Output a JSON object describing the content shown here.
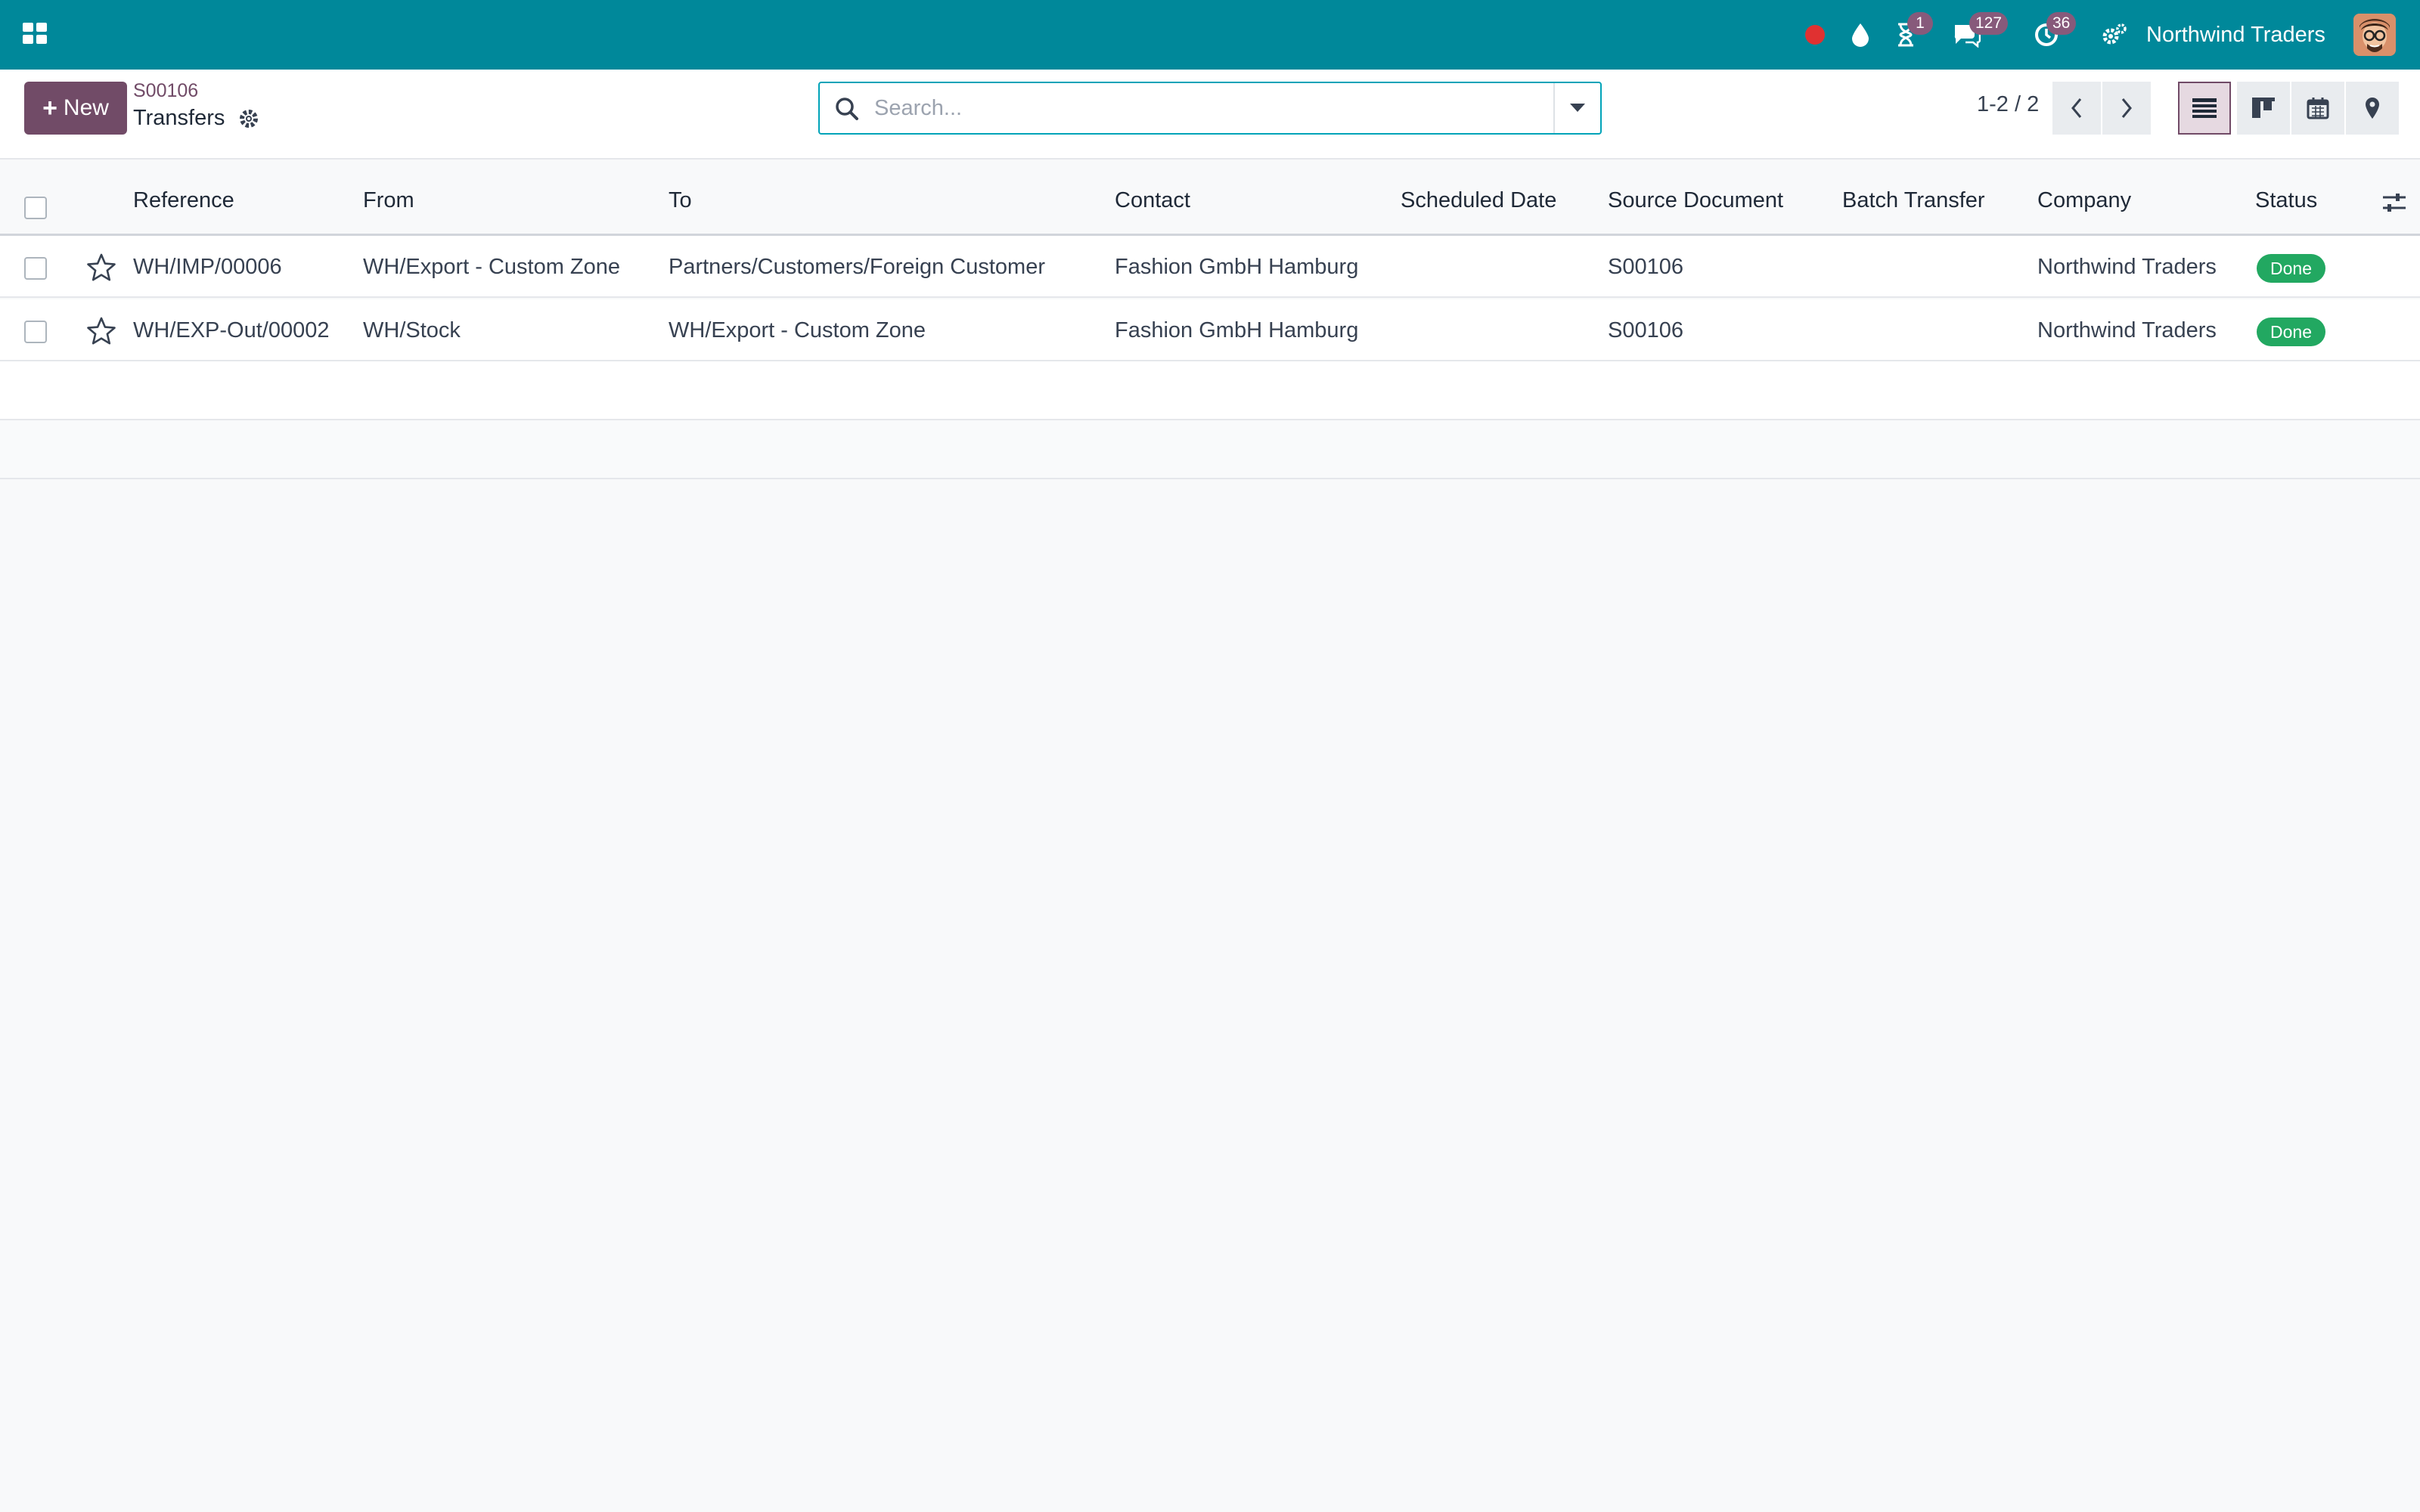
{
  "navbar": {
    "company": "Northwind Traders",
    "badges": {
      "activity": "1",
      "messages": "127",
      "clock": "36"
    },
    "colors": {
      "bar": "#00889a",
      "badge": "#875a7b",
      "recording_dot": "#e03131"
    }
  },
  "control_panel": {
    "new_label": "New",
    "breadcrumb_parent": "S00106",
    "breadcrumb_current": "Transfers",
    "search_placeholder": "Search...",
    "pager": "1-2 / 2",
    "views": [
      "list",
      "kanban",
      "calendar",
      "map"
    ],
    "active_view": "list"
  },
  "table": {
    "columns": {
      "reference": "Reference",
      "from": "From",
      "to": "To",
      "contact": "Contact",
      "scheduled_date": "Scheduled Date",
      "source_document": "Source Document",
      "batch_transfer": "Batch Transfer",
      "company": "Company",
      "status": "Status"
    },
    "rows": [
      {
        "reference": "WH/IMP/00006",
        "from": "WH/Export - Custom Zone",
        "to": "Partners/Customers/Foreign Customer",
        "contact": "Fashion GmbH Hamburg",
        "scheduled_date": "",
        "source_document": "S00106",
        "batch_transfer": "",
        "company": "Northwind Traders",
        "status": "Done"
      },
      {
        "reference": "WH/EXP-Out/00002",
        "from": "WH/Stock",
        "to": "WH/Export - Custom Zone",
        "contact": "Fashion GmbH Hamburg",
        "scheduled_date": "",
        "source_document": "S00106",
        "batch_transfer": "",
        "company": "Northwind Traders",
        "status": "Done"
      }
    ],
    "status_color": "#22a861"
  }
}
